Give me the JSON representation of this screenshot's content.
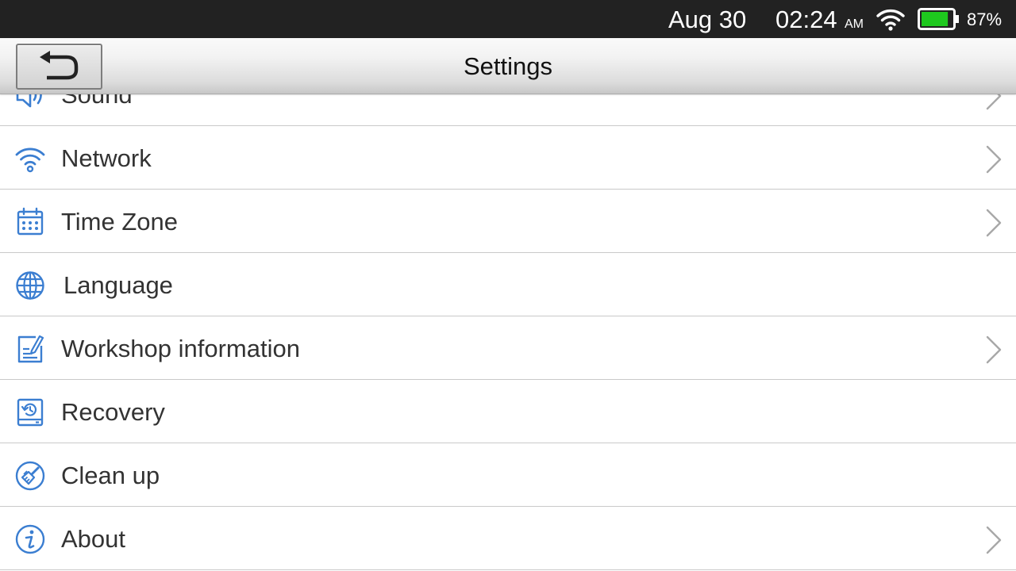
{
  "status_bar": {
    "date": "Aug 30",
    "time": "02:24",
    "ampm": "AM",
    "wifi_icon": "wifi-icon",
    "battery_icon": "battery-icon",
    "battery_level": 0.87,
    "battery_text": "87%",
    "battery_color": "#1ec81e"
  },
  "header": {
    "title": "Settings",
    "back_icon": "undo-arrow-icon"
  },
  "accent_color": "#3b7ed1",
  "settings": {
    "items": [
      {
        "label": "Sound",
        "icon": "speaker-icon",
        "has_chevron": true
      },
      {
        "label": "Network",
        "icon": "wifi-icon",
        "has_chevron": true
      },
      {
        "label": "Time Zone",
        "icon": "calendar-icon",
        "has_chevron": true
      },
      {
        "label": "Language",
        "icon": "globe-icon",
        "has_chevron": false
      },
      {
        "label": "Workshop information",
        "icon": "document-edit-icon",
        "has_chevron": true
      },
      {
        "label": "Recovery",
        "icon": "restore-icon",
        "has_chevron": false
      },
      {
        "label": "Clean up",
        "icon": "broom-icon",
        "has_chevron": false
      },
      {
        "label": "About",
        "icon": "info-icon",
        "has_chevron": true
      }
    ]
  }
}
